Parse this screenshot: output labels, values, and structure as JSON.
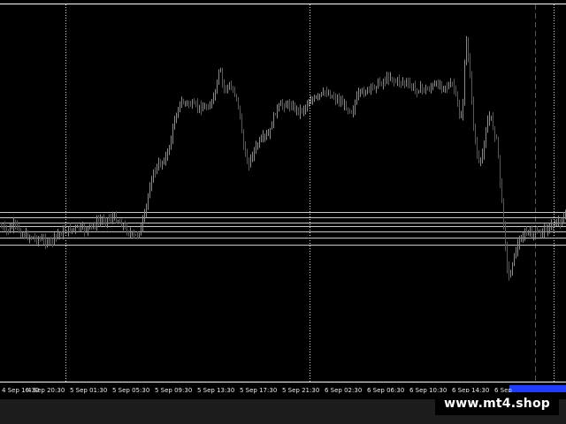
{
  "chart_data": {
    "type": "candlestick",
    "title": "",
    "xlabel": "",
    "ylabel": "",
    "colors": {
      "background": "#000000",
      "bull": "#3fbf3f",
      "bear": "#e02020",
      "grid_vertical": "#d8d8d8",
      "horizontal_levels": "#c8c8c8",
      "period_separator": "#3050e0",
      "axis": "#ffffff",
      "watermark_bg": "#000000"
    },
    "x_tick_labels": [
      "4 Sep 16:30",
      "4 Sep 20:30",
      "5 Sep 01:30",
      "5 Sep 05:30",
      "5 Sep 09:30",
      "5 Sep 13:30",
      "5 Sep 17:30",
      "5 Sep 21:30",
      "6 Sep 02:30",
      "6 Sep 06:30",
      "6 Sep 10:30",
      "6 Sep 14:30",
      "6 Sep"
    ],
    "price_path": [
      [
        0,
        256
      ],
      [
        8,
        262
      ],
      [
        16,
        254
      ],
      [
        24,
        265
      ],
      [
        32,
        268
      ],
      [
        40,
        270
      ],
      [
        48,
        272
      ],
      [
        56,
        275
      ],
      [
        64,
        266
      ],
      [
        72,
        262
      ],
      [
        80,
        260
      ],
      [
        88,
        258
      ],
      [
        96,
        260
      ],
      [
        104,
        256
      ],
      [
        112,
        250
      ],
      [
        120,
        248
      ],
      [
        128,
        246
      ],
      [
        136,
        252
      ],
      [
        144,
        262
      ],
      [
        152,
        268
      ],
      [
        158,
        262
      ],
      [
        164,
        240
      ],
      [
        168,
        215
      ],
      [
        172,
        198
      ],
      [
        178,
        188
      ],
      [
        184,
        182
      ],
      [
        190,
        172
      ],
      [
        196,
        140
      ],
      [
        202,
        118
      ],
      [
        208,
        116
      ],
      [
        214,
        118
      ],
      [
        220,
        120
      ],
      [
        226,
        122
      ],
      [
        232,
        122
      ],
      [
        238,
        118
      ],
      [
        244,
        102
      ],
      [
        248,
        76
      ],
      [
        252,
        100
      ],
      [
        258,
        98
      ],
      [
        264,
        104
      ],
      [
        268,
        112
      ],
      [
        272,
        140
      ],
      [
        276,
        174
      ],
      [
        280,
        186
      ],
      [
        286,
        172
      ],
      [
        292,
        162
      ],
      [
        298,
        156
      ],
      [
        304,
        152
      ],
      [
        310,
        128
      ],
      [
        316,
        120
      ],
      [
        322,
        118
      ],
      [
        330,
        120
      ],
      [
        338,
        126
      ],
      [
        344,
        122
      ],
      [
        350,
        114
      ],
      [
        356,
        112
      ],
      [
        362,
        108
      ],
      [
        368,
        104
      ],
      [
        374,
        108
      ],
      [
        380,
        112
      ],
      [
        386,
        116
      ],
      [
        392,
        122
      ],
      [
        398,
        126
      ],
      [
        404,
        108
      ],
      [
        410,
        104
      ],
      [
        416,
        102
      ],
      [
        422,
        98
      ],
      [
        428,
        94
      ],
      [
        434,
        92
      ],
      [
        440,
        86
      ],
      [
        446,
        92
      ],
      [
        452,
        92
      ],
      [
        458,
        94
      ],
      [
        464,
        98
      ],
      [
        470,
        102
      ],
      [
        476,
        100
      ],
      [
        482,
        102
      ],
      [
        488,
        98
      ],
      [
        494,
        96
      ],
      [
        500,
        96
      ],
      [
        506,
        98
      ],
      [
        512,
        96
      ],
      [
        516,
        112
      ],
      [
        520,
        138
      ],
      [
        524,
        110
      ],
      [
        526,
        40
      ],
      [
        530,
        70
      ],
      [
        534,
        130
      ],
      [
        538,
        172
      ],
      [
        542,
        188
      ],
      [
        546,
        170
      ],
      [
        550,
        140
      ],
      [
        554,
        130
      ],
      [
        558,
        148
      ],
      [
        562,
        162
      ],
      [
        566,
        220
      ],
      [
        570,
        262
      ],
      [
        574,
        318
      ],
      [
        578,
        300
      ],
      [
        584,
        280
      ],
      [
        590,
        268
      ],
      [
        596,
        262
      ],
      [
        602,
        266
      ],
      [
        608,
        264
      ],
      [
        614,
        260
      ],
      [
        620,
        258
      ],
      [
        626,
        254
      ],
      [
        632,
        250
      ],
      [
        638,
        246
      ]
    ]
  },
  "watermark": {
    "text": "www.mt4.shop"
  }
}
